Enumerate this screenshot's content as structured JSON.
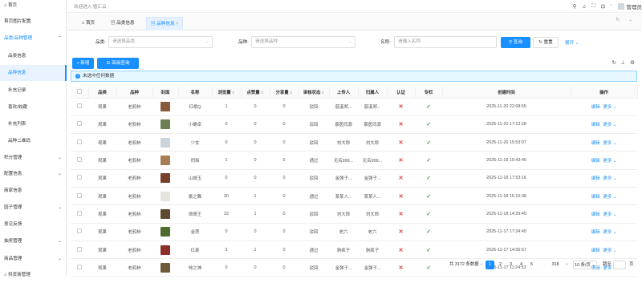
{
  "sidebar": {
    "items": [
      {
        "label": "首页",
        "top": 0
      },
      {
        "label": "首页图片配置"
      },
      {
        "label": "品类/品种管理"
      },
      {
        "label": "品类信息"
      },
      {
        "label": "品种信息"
      },
      {
        "label": "补充记录"
      },
      {
        "label": "喜欢/收藏"
      },
      {
        "label": "补充列表"
      },
      {
        "label": "品种二维码"
      },
      {
        "label": "积分管理"
      },
      {
        "label": "配置信息"
      },
      {
        "label": "商家信息"
      },
      {
        "label": "园子管理"
      },
      {
        "label": "意见反馈"
      },
      {
        "label": "抽奖管理"
      },
      {
        "label": "商品管理"
      },
      {
        "label": "供货商管理"
      }
    ]
  },
  "topbar": {
    "welcome": "欢迎进入 植汇云",
    "user": "管理员"
  },
  "tabs": [
    {
      "label": "首页"
    },
    {
      "label": "品类信息"
    },
    {
      "label": "品种信息"
    }
  ],
  "filters": {
    "category_label": "品类:",
    "category_placeholder": "请选择品类",
    "variety_label": "品种:",
    "variety_placeholder": "请选择品种",
    "name_label": "名称:",
    "name_placeholder": "请输入名称",
    "search": "查询",
    "reset": "重置",
    "expand": "展开"
  },
  "toolbar": {
    "add": "新增",
    "advanced": "高级查询"
  },
  "alert": "未选中任何数据",
  "table": {
    "headers": [
      "",
      "品类",
      "品种",
      "封面",
      "名称",
      "浏览量",
      "点赞量",
      "分享量",
      "审核状态",
      "上传人",
      "归属人",
      "认证",
      "专栏",
      "创建时间",
      "操作"
    ],
    "rows": [
      {
        "cat": "观果",
        "var": "老鸦柿",
        "name": "红梢Q",
        "views": "1",
        "likes": "0",
        "shares": "0",
        "status": "驳回",
        "uploader": "慈溪郑...",
        "owner": "慈溪郑...",
        "time": "2025-11-20 22:08:55",
        "color": "#8a5a3c"
      },
      {
        "cat": "观果",
        "var": "老鸦柿",
        "name": "小确幸",
        "views": "0",
        "likes": "0",
        "shares": "0",
        "status": "驳回",
        "uploader": "慕医同源",
        "owner": "慕医同源",
        "time": "2025-11-20 17:13:28",
        "color": "#6b7f52"
      },
      {
        "cat": "观果",
        "var": "老鸦柿",
        "name": "少女",
        "views": "0",
        "likes": "0",
        "shares": "0",
        "status": "驳回",
        "uploader": "刘大郎",
        "owner": "刘大郎",
        "time": "2025-11-20 15:53:07",
        "color": "#c9d4dc"
      },
      {
        "cat": "观果",
        "var": "老鸦柿",
        "name": "烈焰",
        "views": "1",
        "likes": "0",
        "shares": "0",
        "status": "通过",
        "uploader": "无名999...",
        "owner": "无名999...",
        "time": "2025-11-18 19:43:45",
        "color": "#a77d54"
      },
      {
        "cat": "观果",
        "var": "老鸦柿",
        "name": "山城玉",
        "views": "0",
        "likes": "0",
        "shares": "0",
        "status": "驳回",
        "uploader": "金弹子...",
        "owner": "金弹子...",
        "time": "2025-11-18 17:53:16",
        "color": "#7a3f2a"
      },
      {
        "cat": "观果",
        "var": "老鸦柿",
        "name": "紫之舞",
        "views": "30",
        "likes": "1",
        "shares": "0",
        "status": "通过",
        "uploader": "某某人...",
        "owner": "某某人...",
        "time": "2025-11-18 16:10:38",
        "color": "#e6e2dc"
      },
      {
        "cat": "观果",
        "var": "老鸦柿",
        "name": "琅琊王",
        "views": "22",
        "likes": "1",
        "shares": "0",
        "status": "驳回",
        "uploader": "刘大郎",
        "owner": "刘大郎",
        "time": "2025-11-18 14:29:45",
        "color": "#5e4a30"
      },
      {
        "cat": "观果",
        "var": "老鸦柿",
        "name": "金莲",
        "views": "0",
        "likes": "0",
        "shares": "0",
        "status": "驳回",
        "uploader": "老六",
        "owner": "老六",
        "time": "2025-11-17 17:34:45",
        "color": "#4f6b2f"
      },
      {
        "cat": "观果",
        "var": "老鸦柿",
        "name": "红泉",
        "views": "3",
        "likes": "1",
        "shares": "0",
        "status": "通过",
        "uploader": "驹疯子",
        "owner": "驹疯子",
        "time": "2025-11-17 14:06:57",
        "color": "#8c2f2a"
      },
      {
        "cat": "观果",
        "var": "老鸦柿",
        "name": "柿之神",
        "views": "0",
        "likes": "0",
        "shares": "0",
        "status": "驳回",
        "uploader": "金弹子...",
        "owner": "金弹子...",
        "time": "2025-11-17 11:24:53",
        "color": "#6f5a3a"
      }
    ],
    "edit_label": "编辑",
    "more_label": "更多"
  },
  "pager": {
    "total": "共 3172 条数据",
    "pages": [
      "1",
      "2",
      "3",
      "4",
      "5",
      "···",
      "318"
    ],
    "page_size": "10 条/页",
    "goto": "跳至",
    "page_suffix": "页"
  }
}
